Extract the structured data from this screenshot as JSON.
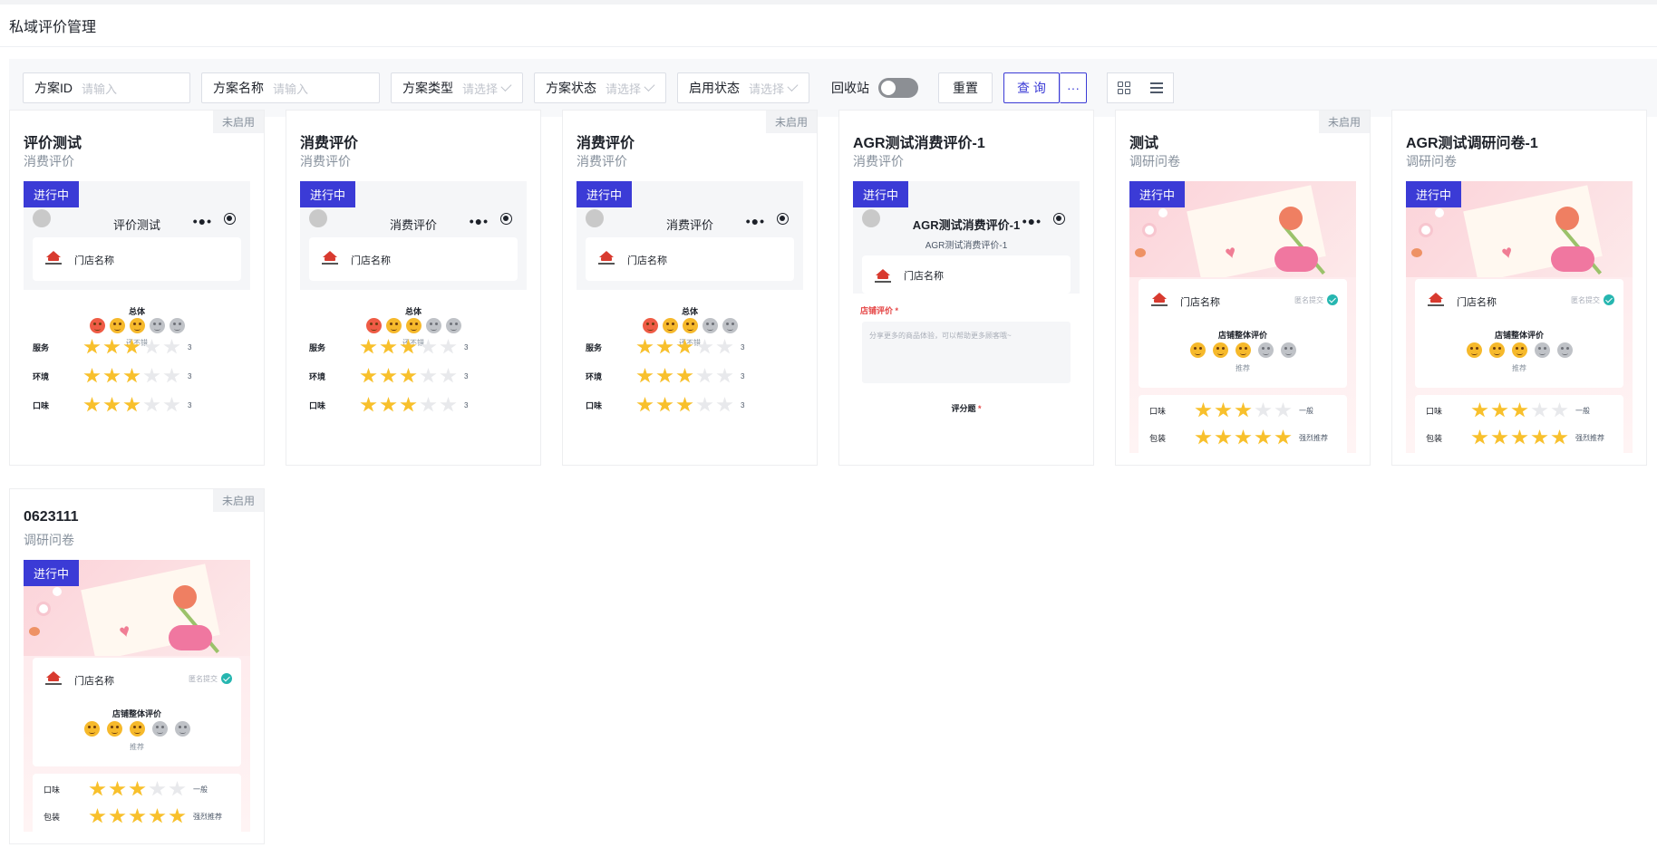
{
  "page_title": "私域评价管理",
  "filters": {
    "plan_id": {
      "label": "方案ID",
      "placeholder": "请输入"
    },
    "plan_name": {
      "label": "方案名称",
      "placeholder": "请输入"
    },
    "plan_type": {
      "label": "方案类型",
      "placeholder": "请选择"
    },
    "plan_status": {
      "label": "方案状态",
      "placeholder": "请选择"
    },
    "enable_status": {
      "label": "启用状态",
      "placeholder": "请选择"
    },
    "recycle_label": "回收站",
    "reset_label": "重置",
    "query_label": "查 询",
    "more_label": "···"
  },
  "cards": [
    {
      "title": "评价测试",
      "type": "消费评价",
      "status": "未启用",
      "badge": "进行中",
      "preview_name": "评价测试",
      "kind": "consumer"
    },
    {
      "title": "消费评价",
      "type": "消费评价",
      "status": "",
      "badge": "进行中",
      "preview_name": "消费评价",
      "kind": "consumer"
    },
    {
      "title": "消费评价",
      "type": "消费评价",
      "status": "未启用",
      "badge": "进行中",
      "preview_name": "消费评价",
      "kind": "consumer"
    },
    {
      "title": "AGR测试消费评价-1",
      "type": "消费评价",
      "status": "",
      "badge": "进行中",
      "preview_name": "AGR测试消费评价-1",
      "preview_sub": "AGR测试消费评价-1",
      "kind": "agr"
    },
    {
      "title": "测试",
      "type": "调研问卷",
      "status": "未启用",
      "badge": "进行中",
      "kind": "survey"
    },
    {
      "title": "AGR测试调研问卷-1",
      "type": "调研问卷",
      "status": "",
      "badge": "进行中",
      "kind": "survey"
    },
    {
      "title": "0623111",
      "type": "调研问卷",
      "status": "未启用",
      "badge": "进行中",
      "kind": "survey"
    }
  ],
  "consumer_preview": {
    "store_name": "门店名称",
    "overall_label": "总体",
    "overall_value": "还不错",
    "rows": [
      {
        "label": "服务",
        "value": "3",
        "stars": 3
      },
      {
        "label": "环境",
        "value": "3",
        "stars": 3
      },
      {
        "label": "口味",
        "value": "3",
        "stars": 3
      }
    ]
  },
  "agr_preview": {
    "store_name": "门店名称",
    "comment_label": "店铺评价",
    "comment_placeholder": "分享更多的商品体验，可以帮助更多顾客哦~",
    "score_label": "评分题"
  },
  "survey_preview": {
    "store_name": "门店名称",
    "anonymous_label": "匿名提交",
    "overall_label": "店铺整体评价",
    "overall_value": "推荐",
    "rows": [
      {
        "label": "口味",
        "value": "一般",
        "stars": 3
      },
      {
        "label": "包装",
        "value": "强烈推荐",
        "stars": 5
      }
    ]
  }
}
